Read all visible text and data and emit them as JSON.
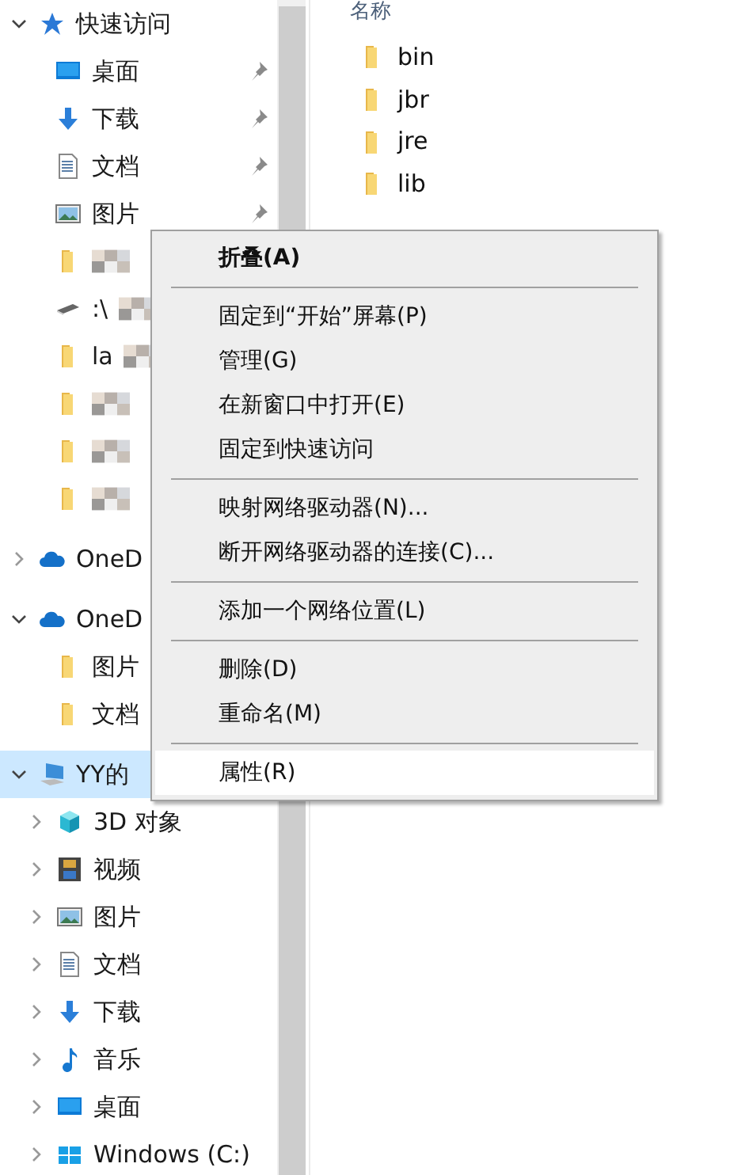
{
  "nav": [
    {
      "label": "快速访问",
      "kind": "star",
      "expanded": true,
      "selected": false,
      "children": [
        {
          "label": "桌面",
          "kind": "desktop",
          "pinned": true
        },
        {
          "label": "下载",
          "kind": "download",
          "pinned": true
        },
        {
          "label": "文档",
          "kind": "document",
          "pinned": true
        },
        {
          "label": "图片",
          "kind": "picture",
          "pinned": true
        },
        {
          "kind": "folder",
          "redacted": true
        },
        {
          "label": ":\\",
          "kind": "drive",
          "redacted": true
        },
        {
          "label": "la",
          "kind": "folder",
          "redacted": true
        },
        {
          "kind": "folder",
          "redacted": true
        },
        {
          "kind": "folder",
          "redacted": true
        },
        {
          "kind": "folder",
          "redacted": true
        }
      ]
    },
    {
      "label": "OneD",
      "kind": "cloud",
      "expanded": false,
      "selected": false
    },
    {
      "label": "OneD",
      "kind": "cloud",
      "expanded": true,
      "selected": false,
      "children": [
        {
          "label": "图片",
          "kind": "folder"
        },
        {
          "label": "文档",
          "kind": "folder"
        }
      ]
    },
    {
      "label": "YY的",
      "kind": "pc",
      "expanded": true,
      "selected": true,
      "children": [
        {
          "label": "3D 对象",
          "kind": "cube",
          "expanded": false
        },
        {
          "label": "视频",
          "kind": "film",
          "expanded": false
        },
        {
          "label": "图片",
          "kind": "picture",
          "expanded": false
        },
        {
          "label": "文档",
          "kind": "document",
          "expanded": false
        },
        {
          "label": "下载",
          "kind": "download",
          "expanded": false
        },
        {
          "label": "音乐",
          "kind": "music",
          "expanded": false
        },
        {
          "label": "桌面",
          "kind": "desktop",
          "expanded": false
        },
        {
          "label": "Windows (C:)",
          "kind": "windows",
          "expanded": false
        }
      ]
    }
  ],
  "files": {
    "column": "名称",
    "items": [
      "bin",
      "jbr",
      "jre",
      "lib"
    ]
  },
  "context_menu": [
    {
      "kind": "item",
      "label": "折叠(A)",
      "bold": true,
      "selected": false
    },
    {
      "kind": "separator"
    },
    {
      "kind": "item",
      "label": "固定到“开始”屏幕(P)",
      "bold": false,
      "selected": false
    },
    {
      "kind": "item",
      "label": "管理(G)",
      "bold": false,
      "selected": false
    },
    {
      "kind": "item",
      "label": "在新窗口中打开(E)",
      "bold": false,
      "selected": false
    },
    {
      "kind": "item",
      "label": "固定到快速访问",
      "bold": false,
      "selected": false
    },
    {
      "kind": "separator"
    },
    {
      "kind": "item",
      "label": "映射网络驱动器(N)...",
      "bold": false,
      "selected": false
    },
    {
      "kind": "item",
      "label": "断开网络驱动器的连接(C)...",
      "bold": false,
      "selected": false
    },
    {
      "kind": "separator"
    },
    {
      "kind": "item",
      "label": "添加一个网络位置(L)",
      "bold": false,
      "selected": false
    },
    {
      "kind": "separator"
    },
    {
      "kind": "item",
      "label": "删除(D)",
      "bold": false,
      "selected": false
    },
    {
      "kind": "item",
      "label": "重命名(M)",
      "bold": false,
      "selected": false
    },
    {
      "kind": "separator"
    },
    {
      "kind": "item",
      "label": "属性(R)",
      "bold": false,
      "selected": true
    }
  ]
}
